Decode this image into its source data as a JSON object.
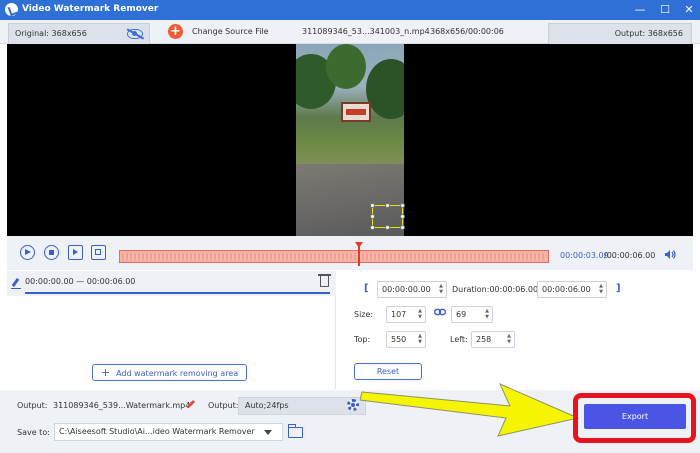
{
  "window": {
    "title": "Video Watermark Remover",
    "controls": [
      "—",
      "☐",
      "✕"
    ]
  },
  "toolbar": {
    "original_label": "Original: 368x656",
    "change_source_label": "Change Source File",
    "file_name": "311089346_53...341003_n.mp4",
    "file_meta": "368x656/00:00:06",
    "output_label": "Output: 368x656"
  },
  "playback": {
    "current_time": "00:00:03.09",
    "total_time": "/00:00:06.00",
    "progress": 0.52
  },
  "segment": {
    "range": "00:00:00.00 — 00:00:06.00"
  },
  "add_area_label": "Add watermark removing area",
  "settings": {
    "start_time": "00:00:00.00",
    "duration_label": "Duration:00:00:06.00",
    "end_time": "00:00:06.00",
    "size_label": "Size:",
    "width": "107",
    "height": "69",
    "top_label": "Top:",
    "top": "550",
    "left_label": "Left:",
    "left": "258",
    "reset_label": "Reset"
  },
  "bottom": {
    "output_label": "Output:",
    "output_file": "311089346_539...Watermark.mp4",
    "output_format_label": "Output:",
    "output_format": "Auto;24fps",
    "save_label": "Save to:",
    "save_path": "C:\\Aiseesoft Studio\\Ai...ideo Watermark Remover",
    "export_label": "Export"
  },
  "colors": {
    "titlebar": "#2f70d6",
    "accent": "#3b5fc7",
    "export": "#4a55e6",
    "highlight": "#e8141d",
    "annotation_arrow": "#f5f500"
  }
}
